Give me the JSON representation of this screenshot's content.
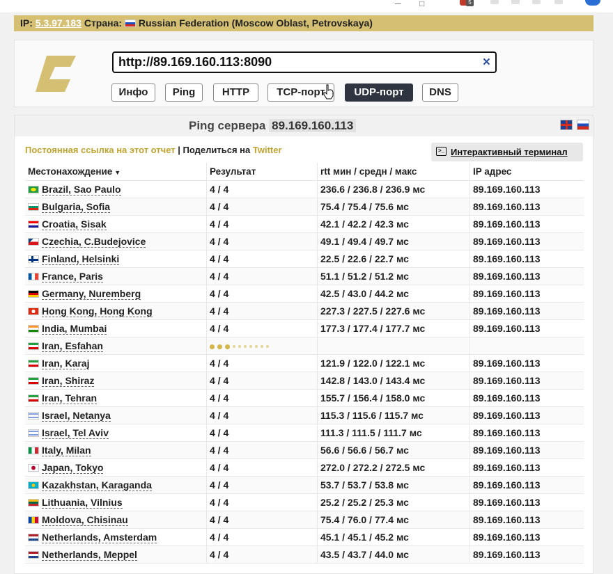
{
  "ipbar": {
    "ip_label": "IP:",
    "ip_value": "5.3.97.183",
    "country_label": "Страна:",
    "country_value": "Russian Federation (Moscow Oblast, Petrovskaya)"
  },
  "header": {
    "url_value": "http://89.169.160.113:8090",
    "clear_icon": "×",
    "tabs": [
      "Инфо",
      "Ping",
      "HTTP",
      "TCP-порт",
      "UDP-порт",
      "DNS"
    ],
    "active_tab": "UDP-порт"
  },
  "panel": {
    "title_prefix": "Ping сервера",
    "title_host": "89.169.160.113",
    "permalink": "Постоянная ссылка на этот отчет",
    "separator": "|",
    "share_label": "Поделиться на",
    "twitter": "Twitter",
    "terminal_button": "Интерактивный терминал"
  },
  "table": {
    "headers": [
      "Местонахождение",
      "Результат",
      "rtt мин / средн / макс",
      "IP адрес"
    ],
    "sort_arrow": "▼",
    "rows": [
      {
        "location": "Brazil, Sao Paulo",
        "result": "4 / 4",
        "rtt": "236.6 / 236.8 / 236.9 мс",
        "ip": "89.169.160.113",
        "flag": "br"
      },
      {
        "location": "Bulgaria, Sofia",
        "result": "4 / 4",
        "rtt": "75.4 / 75.4 / 75.6 мс",
        "ip": "89.169.160.113",
        "flag": "bg"
      },
      {
        "location": "Croatia, Sisak",
        "result": "4 / 4",
        "rtt": "42.1 / 42.2 / 42.3 мс",
        "ip": "89.169.160.113",
        "flag": "hr"
      },
      {
        "location": "Czechia, C.Budejovice",
        "result": "4 / 4",
        "rtt": "49.1 / 49.4 / 49.7 мс",
        "ip": "89.169.160.113",
        "flag": "cz"
      },
      {
        "location": "Finland, Helsinki",
        "result": "4 / 4",
        "rtt": "22.5 / 22.6 / 22.7 мс",
        "ip": "89.169.160.113",
        "flag": "fi"
      },
      {
        "location": "France, Paris",
        "result": "4 / 4",
        "rtt": "51.1 / 51.2 / 51.2 мс",
        "ip": "89.169.160.113",
        "flag": "fr"
      },
      {
        "location": "Germany, Nuremberg",
        "result": "4 / 4",
        "rtt": "42.5 / 43.0 / 44.2 мс",
        "ip": "89.169.160.113",
        "flag": "de"
      },
      {
        "location": "Hong Kong, Hong Kong",
        "result": "4 / 4",
        "rtt": "227.3 / 227.5 / 227.6 мс",
        "ip": "89.169.160.113",
        "flag": "hk"
      },
      {
        "location": "India, Mumbai",
        "result": "4 / 4",
        "rtt": "177.3 / 177.4 / 177.7 мс",
        "ip": "89.169.160.113",
        "flag": "in"
      },
      {
        "location": "Iran, Esfahan",
        "result": "",
        "rtt": "",
        "ip": "",
        "flag": "ir",
        "pending": true
      },
      {
        "location": "Iran, Karaj",
        "result": "4 / 4",
        "rtt": "121.9 / 122.0 / 122.1 мс",
        "ip": "89.169.160.113",
        "flag": "ir"
      },
      {
        "location": "Iran, Shiraz",
        "result": "4 / 4",
        "rtt": "142.8 / 143.0 / 143.4 мс",
        "ip": "89.169.160.113",
        "flag": "ir"
      },
      {
        "location": "Iran, Tehran",
        "result": "4 / 4",
        "rtt": "155.7 / 156.4 / 158.0 мс",
        "ip": "89.169.160.113",
        "flag": "ir"
      },
      {
        "location": "Israel, Netanya",
        "result": "4 / 4",
        "rtt": "115.3 / 115.6 / 115.7 мс",
        "ip": "89.169.160.113",
        "flag": "il"
      },
      {
        "location": "Israel, Tel Aviv",
        "result": "4 / 4",
        "rtt": "111.3 / 111.5 / 111.7 мс",
        "ip": "89.169.160.113",
        "flag": "il"
      },
      {
        "location": "Italy, Milan",
        "result": "4 / 4",
        "rtt": "56.6 / 56.6 / 56.7 мс",
        "ip": "89.169.160.113",
        "flag": "it"
      },
      {
        "location": "Japan, Tokyo",
        "result": "4 / 4",
        "rtt": "272.0 / 272.2 / 272.5 мс",
        "ip": "89.169.160.113",
        "flag": "jp"
      },
      {
        "location": "Kazakhstan, Karaganda",
        "result": "4 / 4",
        "rtt": "53.7 / 53.7 / 53.8 мс",
        "ip": "89.169.160.113",
        "flag": "kz"
      },
      {
        "location": "Lithuania, Vilnius",
        "result": "4 / 4",
        "rtt": "25.2 / 25.2 / 25.3 мс",
        "ip": "89.169.160.113",
        "flag": "lt"
      },
      {
        "location": "Moldova, Chisinau",
        "result": "4 / 4",
        "rtt": "75.4 / 76.0 / 77.4 мс",
        "ip": "89.169.160.113",
        "flag": "md"
      },
      {
        "location": "Netherlands, Amsterdam",
        "result": "4 / 4",
        "rtt": "45.1 / 45.1 / 45.2 мс",
        "ip": "89.169.160.113",
        "flag": "nl"
      },
      {
        "location": "Netherlands, Meppel",
        "result": "4 / 4",
        "rtt": "43.5 / 43.7 / 44.0 мс",
        "ip": "89.169.160.113",
        "flag": "nl"
      }
    ]
  },
  "flag_colors": {
    "br": [
      "#229e45",
      "#f8e509"
    ],
    "bg": [
      "#ffffff",
      "#00966e",
      "#d62612"
    ],
    "hr": [
      "#ff0000",
      "#ffffff",
      "#171796"
    ],
    "cz": [
      "#ffffff",
      "#d7141a",
      "#11457e"
    ],
    "fi": [
      "#ffffff",
      "#003580"
    ],
    "fr": [
      "#0055a4",
      "#ffffff",
      "#ef4135"
    ],
    "de": [
      "#000000",
      "#dd0000",
      "#ffce00"
    ],
    "hk": [
      "#de2910",
      "#ffffff"
    ],
    "in": [
      "#ff9933",
      "#ffffff",
      "#138808"
    ],
    "ir": [
      "#239f40",
      "#ffffff",
      "#da0000"
    ],
    "il": [
      "#ffffff",
      "#0038b8"
    ],
    "it": [
      "#009246",
      "#ffffff",
      "#ce2b37"
    ],
    "jp": [
      "#ffffff",
      "#bc002d"
    ],
    "kz": [
      "#00afca",
      "#fec50c"
    ],
    "lt": [
      "#fdb913",
      "#006a44",
      "#c1272d"
    ],
    "md": [
      "#0046ae",
      "#ffd200",
      "#cc092f"
    ],
    "nl": [
      "#ae1c28",
      "#ffffff",
      "#21468b"
    ]
  },
  "colors": {
    "ipbar_bg": "#d4bf72",
    "gold_link": "#c2a430",
    "active_tab_bg": "#2f3441",
    "pending_dots": "#d4b54a"
  }
}
